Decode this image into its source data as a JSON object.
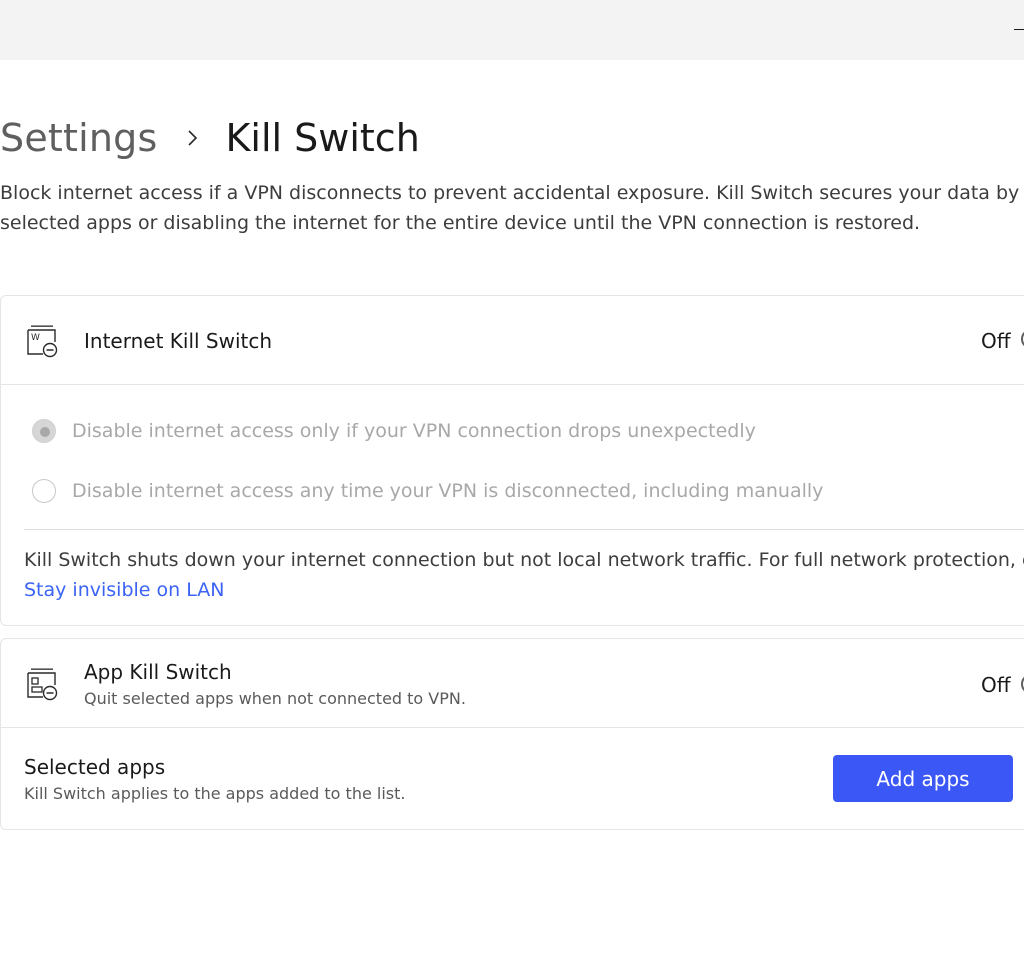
{
  "breadcrumb": {
    "parent": "Settings",
    "separator_icon": "chevron-right-icon",
    "current": "Kill Switch"
  },
  "description": {
    "line1": "Block internet access if a VPN disconnects to prevent accidental exposure. Kill Switch secures your data by quitt",
    "line2": "selected apps or disabling the internet for the entire device until the VPN connection is restored."
  },
  "internet_kill_switch": {
    "icon": "internet-kill-switch-icon",
    "title": "Internet Kill Switch",
    "state_label": "Off",
    "enabled": false,
    "options": [
      {
        "label": "Disable internet access only if your VPN connection drops unexpectedly",
        "selected": true
      },
      {
        "label": "Disable internet access any time your VPN is disconnected, including manually",
        "selected": false
      }
    ],
    "note_text": "Kill Switch shuts down your internet connection but not local network traffic. For full network protection, ena",
    "note_link": "Stay invisible on LAN"
  },
  "app_kill_switch": {
    "icon": "app-kill-switch-icon",
    "title": "App Kill Switch",
    "subtitle": "Quit selected apps when not connected to VPN.",
    "state_label": "Off",
    "enabled": false,
    "selected_apps_title": "Selected apps",
    "selected_apps_subtitle": "Kill Switch applies to the apps added to the list.",
    "add_button_label": "Add apps"
  },
  "colors": {
    "accent": "#3b57f6",
    "link": "#3b63f5",
    "titlebar": "#f3f3f3",
    "disabled_text": "#a8a8a8"
  }
}
